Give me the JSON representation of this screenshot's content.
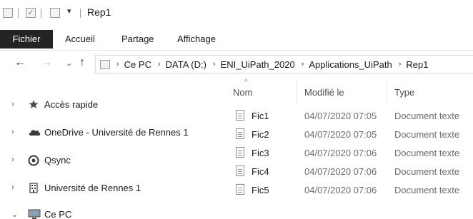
{
  "window": {
    "title": "Rep1"
  },
  "quick_access": {
    "dropdown_glyph": "▾"
  },
  "ribbon": {
    "tabs": [
      {
        "label": "Fichier",
        "active": true
      },
      {
        "label": "Accueil"
      },
      {
        "label": "Partage"
      },
      {
        "label": "Affichage"
      }
    ]
  },
  "nav": {
    "back_icon": "←",
    "forward_icon": "→",
    "recent_icon": "⌄",
    "up_icon": "↑"
  },
  "address": {
    "separator": "›",
    "breadcrumbs": [
      "Ce PC",
      "DATA (D:)",
      "ENI_UiPath_2020",
      "Applications_UiPath",
      "Rep1"
    ]
  },
  "navpane": {
    "items": [
      {
        "label": "Accès rapide",
        "icon": "pin-star-icon",
        "chevron": "›"
      },
      {
        "label": "OneDrive - Université de Rennes 1",
        "icon": "cloud-icon",
        "chevron": "›"
      },
      {
        "label": "Qsync",
        "icon": "qsync-icon",
        "chevron": "›"
      },
      {
        "label": "Université de Rennes 1",
        "icon": "building-icon",
        "chevron": "›"
      },
      {
        "label": "Ce PC",
        "icon": "computer-icon",
        "chevron": "⌄"
      }
    ]
  },
  "filelist": {
    "columns": {
      "name": "Nom",
      "modified": "Modifié le",
      "type": "Type"
    },
    "sort_glyph": "^",
    "files": [
      {
        "name": "Fic1",
        "modified": "04/07/2020 07:05",
        "type": "Document texte"
      },
      {
        "name": "Fic2",
        "modified": "04/07/2020 07:05",
        "type": "Document texte"
      },
      {
        "name": "Fic3",
        "modified": "04/07/2020 07:06",
        "type": "Document texte"
      },
      {
        "name": "Fic4",
        "modified": "04/07/2020 07:06",
        "type": "Document texte"
      },
      {
        "name": "Fic5",
        "modified": "04/07/2020 07:06",
        "type": "Document texte"
      }
    ]
  },
  "colors": {
    "file_tab_bg": "#232323",
    "text_primary": "#1a1a1a",
    "text_secondary": "#6d6d6d"
  }
}
